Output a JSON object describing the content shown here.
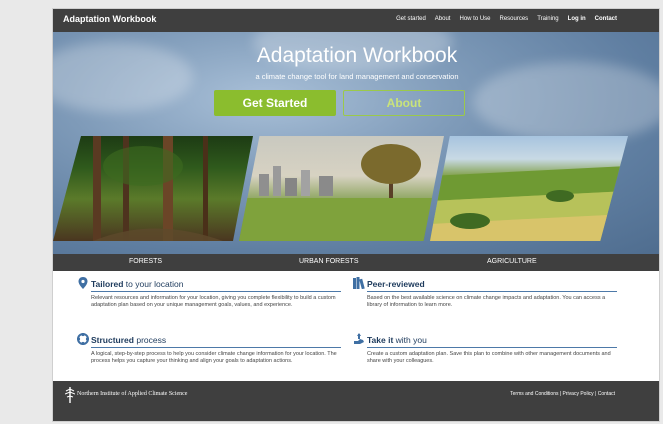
{
  "header": {
    "brand": "Adaptation Workbook",
    "nav": [
      "Get started",
      "About",
      "How to Use",
      "Resources",
      "Training",
      "Log in",
      "Contact"
    ]
  },
  "hero": {
    "title": "Adaptation Workbook",
    "subtitle": "a climate change tool for land management and conservation",
    "primary_button": "Get Started",
    "secondary_button": "About"
  },
  "categories": [
    "FORESTS",
    "URBAN FORESTS",
    "AGRICULTURE"
  ],
  "features": [
    {
      "title_bold": "Tailored",
      "title_rest": " to your location",
      "text": "Relevant resources and information for your location, giving you complete flexibility to build a custom adaptation plan based on your unique management goals, values, and experience."
    },
    {
      "title_bold": "Peer-reviewed",
      "title_rest": "",
      "text": "Based on the best available science on climate change impacts and adaptation. You can access a library of information to learn more."
    },
    {
      "title_bold": "Structured",
      "title_rest": " process",
      "text": "A logical, step-by-step process to help you consider climate change information for your location. The process helps you capture your thinking and align your goals to adaptation actions."
    },
    {
      "title_bold": "Take it",
      "title_rest": " with you",
      "text": "Create a custom adaptation plan. Save this plan to combine with other management documents and share with your colleagues."
    }
  ],
  "footer": {
    "organization": "Northern Institute of Applied Climate Science",
    "links_text": "Terms and Conditions | Privacy Policy | Contact"
  },
  "colors": {
    "accent": "#8bbd2e",
    "heading": "#1d3a5c",
    "icon": "#3f6fa3",
    "bar": "#3f3f3f"
  },
  "icons": [
    "map-pin-icon",
    "books-icon",
    "process-icon",
    "hand-icon",
    "tree-logo-icon"
  ]
}
